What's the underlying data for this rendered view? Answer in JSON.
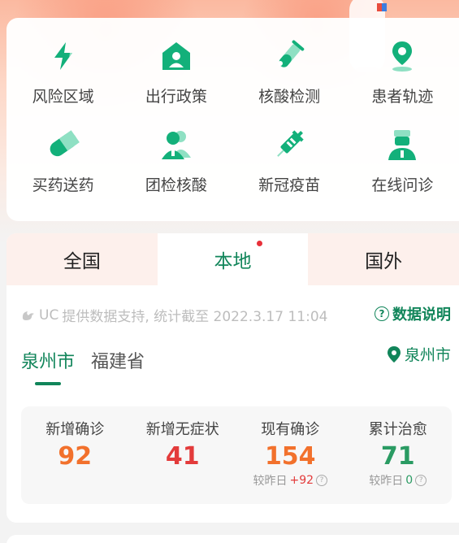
{
  "services": [
    {
      "label": "风险区域",
      "icon": "lightning-icon"
    },
    {
      "label": "出行政策",
      "icon": "house-person-icon"
    },
    {
      "label": "核酸检测",
      "icon": "test-tube-icon"
    },
    {
      "label": "患者轨迹",
      "icon": "location-pin-icon"
    },
    {
      "label": "买药送药",
      "icon": "capsule-icon"
    },
    {
      "label": "团检核酸",
      "icon": "group-icon"
    },
    {
      "label": "新冠疫苗",
      "icon": "syringe-icon"
    },
    {
      "label": "在线问诊",
      "icon": "doctor-icon"
    }
  ],
  "tabs": [
    {
      "label": "全国"
    },
    {
      "label": "本地"
    },
    {
      "label": "国外"
    }
  ],
  "source_prefix": "UC",
  "source_text": "提供数据支持, 统计截至 2022.3.17 11:04",
  "explain_label": "数据说明",
  "subtabs": [
    {
      "label": "泉州市"
    },
    {
      "label": "福建省"
    }
  ],
  "location": "泉州市",
  "metrics": [
    {
      "label": "新增确诊",
      "value": "92",
      "color": "#f2712c"
    },
    {
      "label": "新增无症状",
      "value": "41",
      "color": "#e33b3b"
    },
    {
      "label": "现有确诊",
      "value": "154",
      "color": "#f2712c",
      "delta_prefix": "较昨日",
      "delta": "+92",
      "delta_color": "#e33b3b"
    },
    {
      "label": "累计治愈",
      "value": "71",
      "color": "#2a9b63",
      "delta_prefix": "较昨日",
      "delta": "0",
      "delta_color": "#2a9b63"
    }
  ],
  "colors": {
    "accent": "#11855a",
    "icon": "#13b07a",
    "icon_light": "#8fe0c3"
  }
}
